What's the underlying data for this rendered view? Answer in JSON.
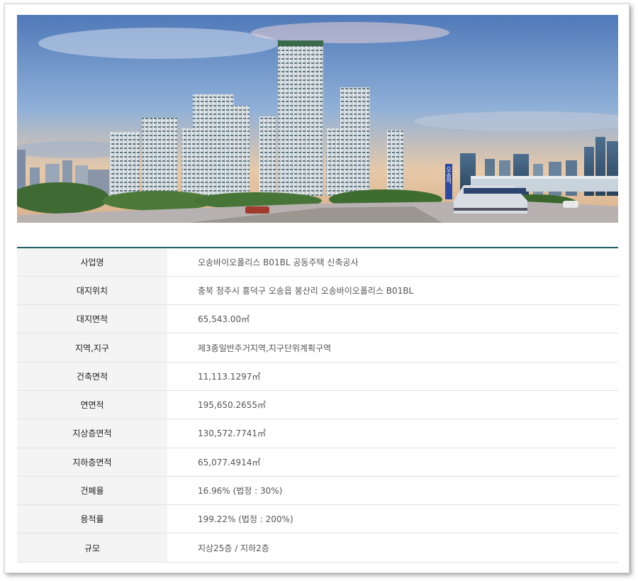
{
  "rows": [
    {
      "label": "사업명",
      "value": "오송바이오폴리스 B01BL 공동주택 신축공사"
    },
    {
      "label": "대지위치",
      "value": "충북 청주시 흥덕구 오송읍 봉산리 오송바이오폴리스 B01BL"
    },
    {
      "label": "대지면적",
      "value": "65,543.00㎡"
    },
    {
      "label": "지역,지구",
      "value": "제3종일반주거지역,지구단위계획구역"
    },
    {
      "label": "건축면적",
      "value": "11,113.1297㎡"
    },
    {
      "label": "연면적",
      "value": "195,650.2655㎡"
    },
    {
      "label": "지상층면적",
      "value": "130,572.7741㎡"
    },
    {
      "label": "지하층면적",
      "value": "65,077.4914㎡"
    },
    {
      "label": "건폐율",
      "value": "16.96% (법정 : 30%)"
    },
    {
      "label": "용적률",
      "value": "199.22% (법정 : 200%)"
    },
    {
      "label": "규모",
      "value": "지상25층 / 지하2층"
    }
  ],
  "hero": {
    "station_sign": "오송역"
  },
  "colors": {
    "table_top_border": "#1f5c63",
    "label_bg": "#f4f4f4"
  }
}
